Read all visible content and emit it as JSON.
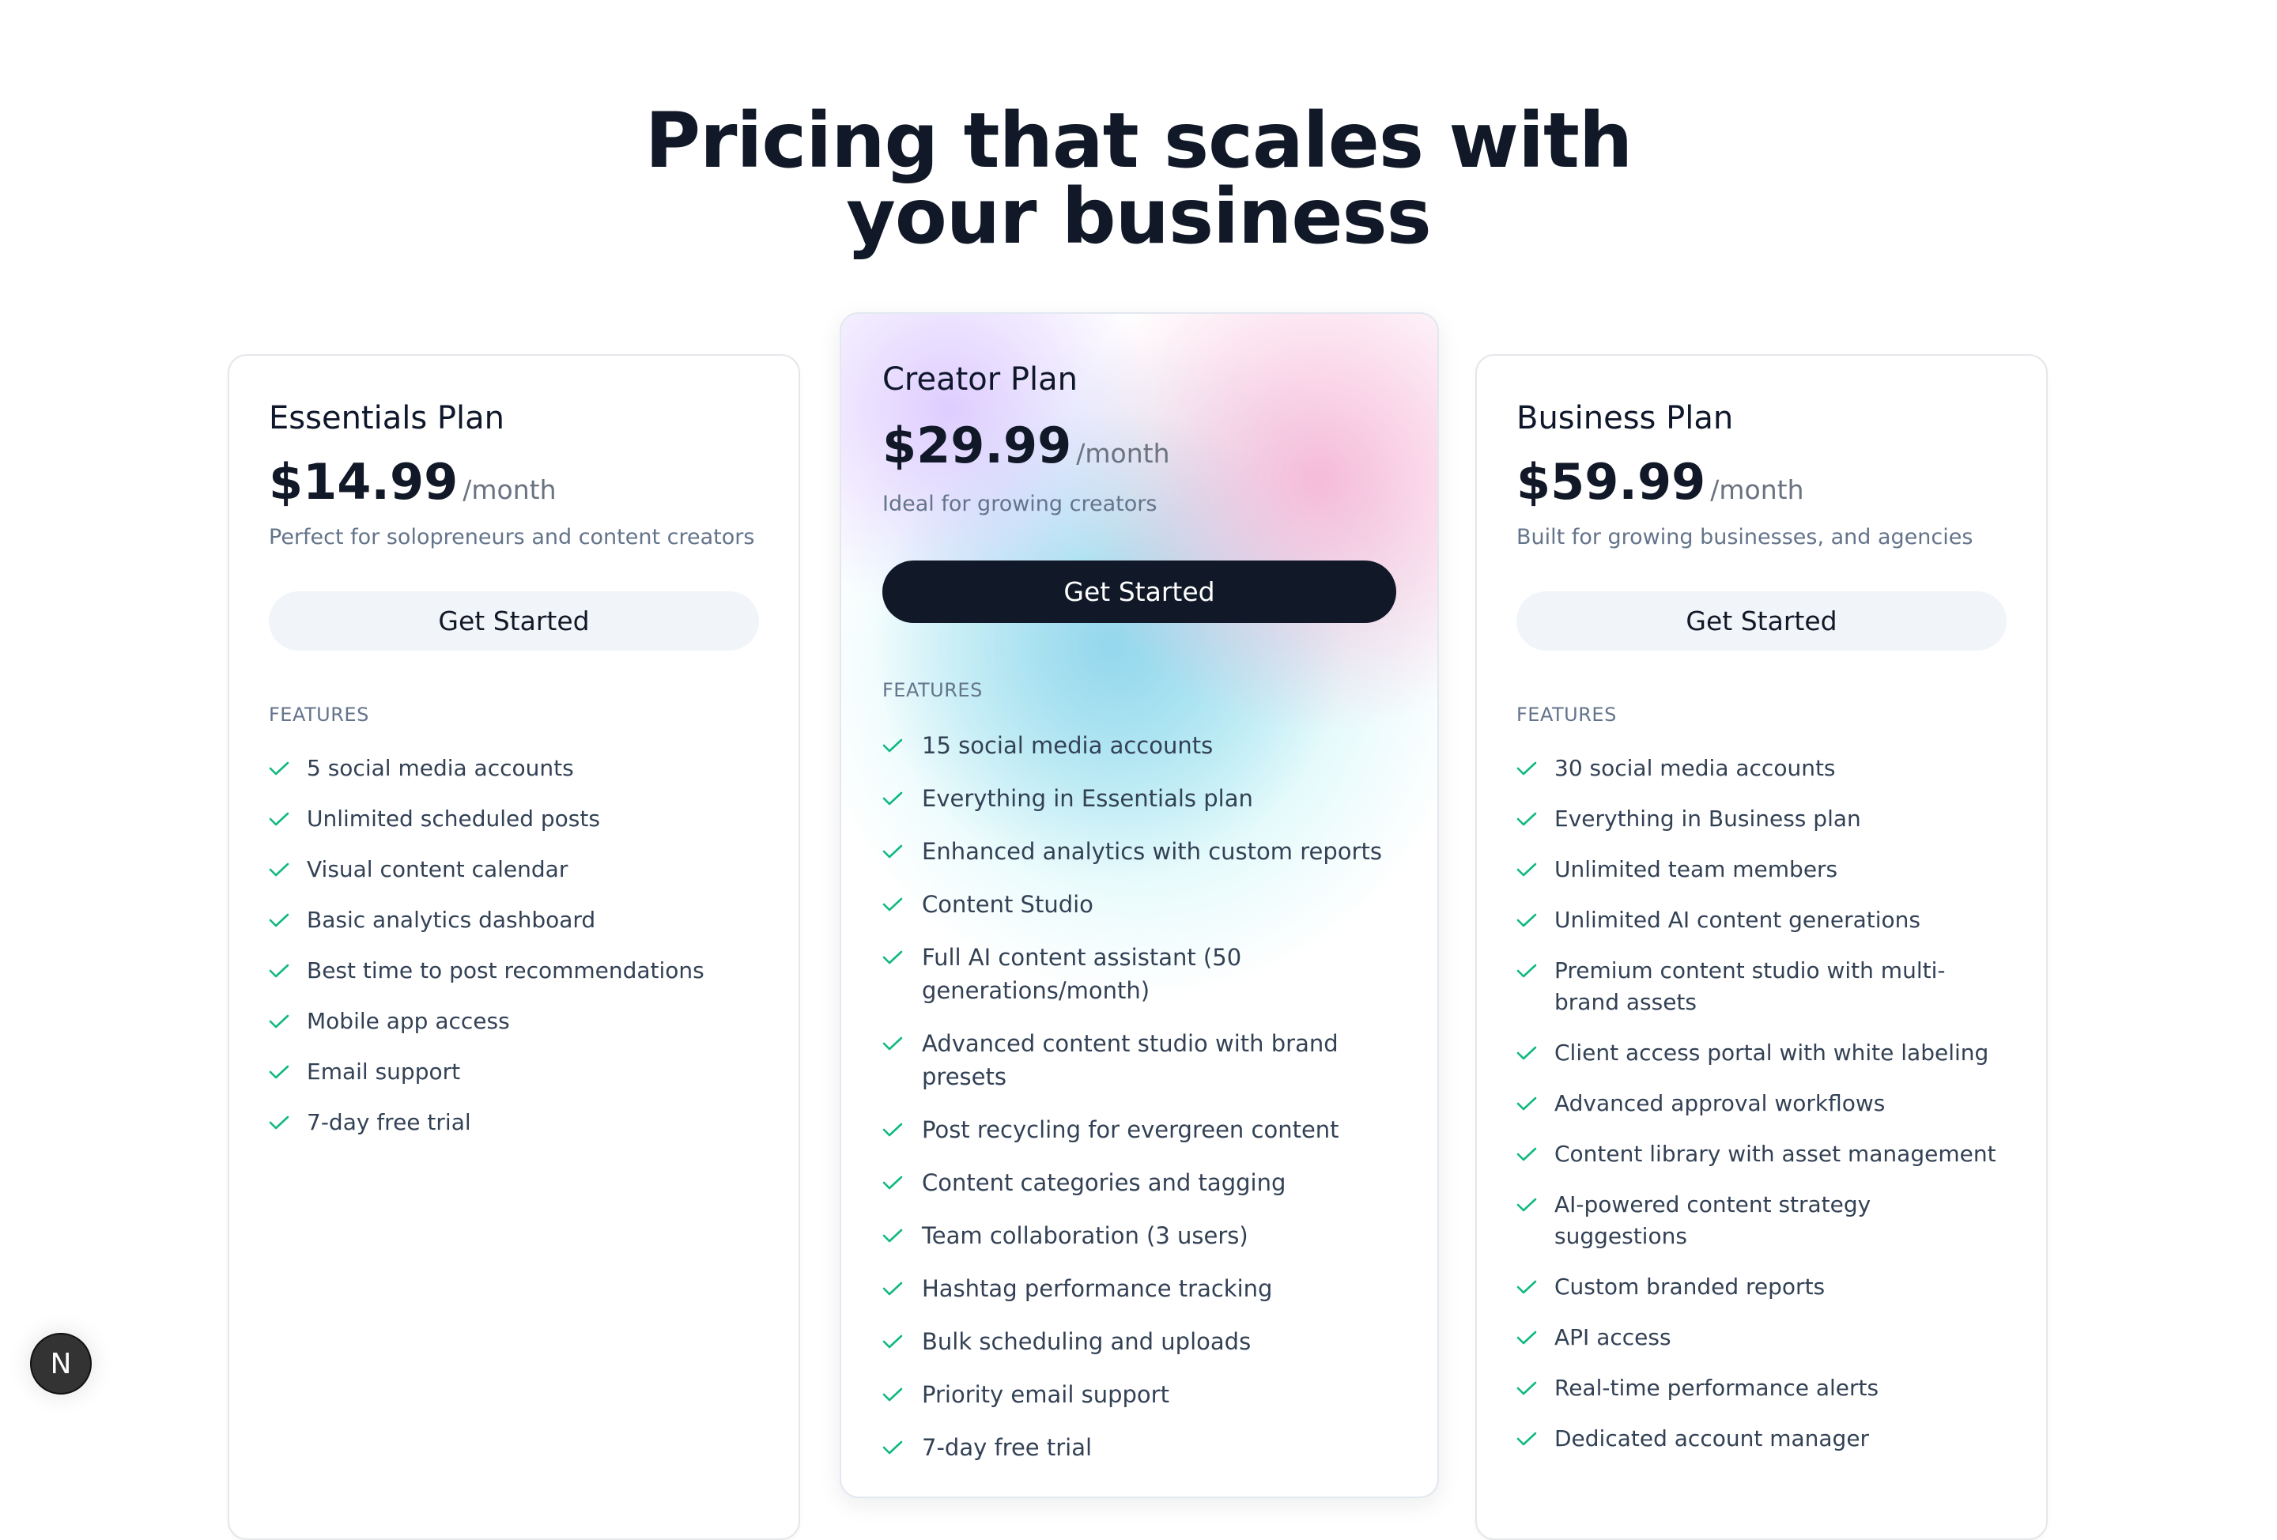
{
  "heading": {
    "line1": "Pricing that scales with",
    "line2": "your business"
  },
  "colors": {
    "check": "#10b981",
    "primary_button": "#111827",
    "secondary_button": "#f1f5f9"
  },
  "plans": [
    {
      "name": "Essentials Plan",
      "price": "$14.99",
      "period": "/month",
      "description": "Perfect for solopreneurs and content creators",
      "button": "Get Started",
      "features_label": "FEATURES",
      "features": [
        "5 social media accounts",
        "Unlimited scheduled posts",
        "Visual content calendar",
        "Basic analytics dashboard",
        "Best time to post recommendations",
        "Mobile app access",
        "Email support",
        "7-day free trial"
      ]
    },
    {
      "name": "Creator Plan",
      "price": "$29.99",
      "period": "/month",
      "description": "Ideal for growing creators",
      "button": "Get Started",
      "features_label": "FEATURES",
      "features": [
        "15 social media accounts",
        "Everything in Essentials plan",
        "Enhanced analytics with custom reports",
        "Content Studio",
        "Full AI content assistant (50 generations/month)",
        "Advanced content studio with brand presets",
        "Post recycling for evergreen content",
        "Content categories and tagging",
        "Team collaboration (3 users)",
        "Hashtag performance tracking",
        "Bulk scheduling and uploads",
        "Priority email support",
        "7-day free trial"
      ]
    },
    {
      "name": "Business Plan",
      "price": "$59.99",
      "period": "/month",
      "description": "Built for growing businesses, and agencies",
      "button": "Get Started",
      "features_label": "FEATURES",
      "features": [
        "30 social media accounts",
        "Everything in Business plan",
        "Unlimited team members",
        "Unlimited AI content generations",
        "Premium content studio with multi-brand assets",
        "Client access portal with white labeling",
        "Advanced approval workflows",
        "Content library with asset management",
        "AI-powered content strategy suggestions",
        "Custom branded reports",
        "API access",
        "Real-time performance alerts",
        "Dedicated account manager"
      ]
    }
  ],
  "dev_badge": {
    "letter": "N",
    "icon": "nextjs-icon"
  }
}
